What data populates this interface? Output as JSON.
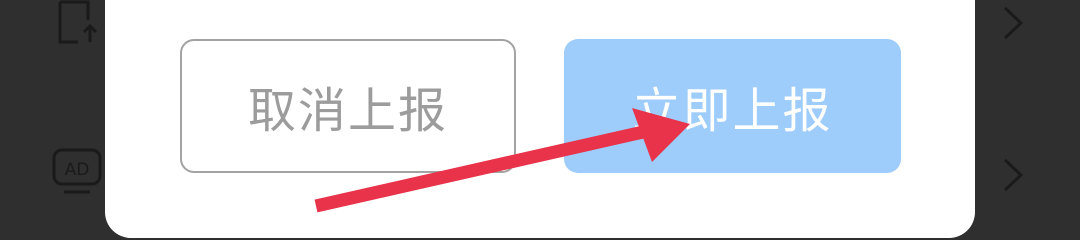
{
  "dialog": {
    "cancel_label": "取消上报",
    "report_label": "立即上报"
  },
  "background_list": {
    "icons": [
      "export-icon",
      "ad-icon"
    ],
    "chevrons": [
      "chevron-right-icon",
      "chevron-right-icon"
    ]
  },
  "annotation": {
    "type": "arrow",
    "color": "#e8334a",
    "points_to": "report-button"
  },
  "colors": {
    "report_button": "#9fcdfb",
    "cancel_border": "#a3a3a3",
    "backdrop": "#2f2f2f"
  }
}
